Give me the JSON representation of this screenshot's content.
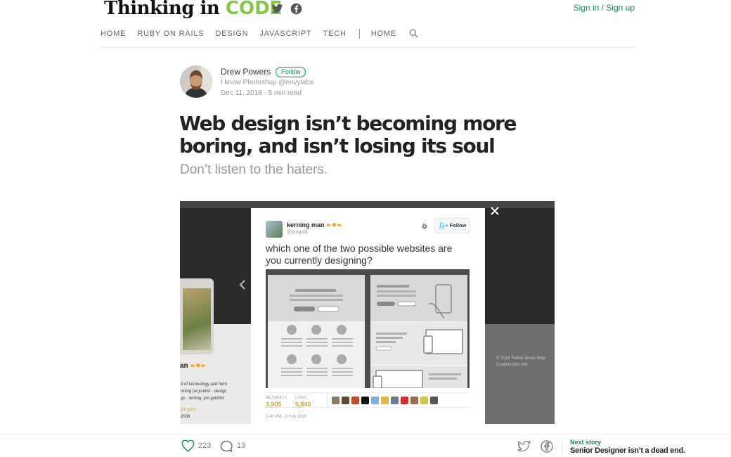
{
  "header": {
    "logo_main": "Thinking in ",
    "logo_accent": "CODE",
    "signin_label": "Sign in / Sign up",
    "social": [
      "twitter-icon",
      "facebook-icon"
    ]
  },
  "nav": {
    "items": [
      "HOME",
      "RUBY ON RAILS",
      "DESIGN",
      "JAVASCRIPT",
      "TECH"
    ],
    "home_label": "HOME"
  },
  "author": {
    "name": "Drew Powers",
    "follow_label": "Follow",
    "bio": "I know Photoshop @envylabs",
    "date": "Dec 11, 2016",
    "read_time": "5 min read"
  },
  "article": {
    "title": "Web design isn’t becoming more boring, and isn’t losing its soul",
    "subtitle": "Don’t listen to the haters."
  },
  "tweet": {
    "display_name": "kerning man",
    "emoji": "➽✸➽",
    "handle": "@jongold",
    "follow_label": "Follow",
    "text": "which one of the two possible websites are you currently designing?",
    "retweets_label": "RETWEETS",
    "retweets": "3,905",
    "likes_label": "LIKES",
    "likes": "5,845",
    "timestamp": "1:40 PM - 2 Feb 2016"
  },
  "background_fragments": {
    "name_frag": "an",
    "line1": "d of technology and form ·",
    "line2": "rming (oc)cultist · design",
    "line3": "gn · writing: jon.gold/txt",
    "line4": "jon.gold",
    "line5": "2008",
    "footer_links": "© 2016 Twitter  About  Help  Cookies  Ads info"
  },
  "bottombar": {
    "likes": "223",
    "responses": "13",
    "next_label": "Next story",
    "next_title": "Senior Designer isn’t a dead end."
  },
  "colors": {
    "accent_green": "#1a8b57",
    "logo_green": "#86c44b",
    "tweet_stat_gold": "#c5a34c"
  }
}
